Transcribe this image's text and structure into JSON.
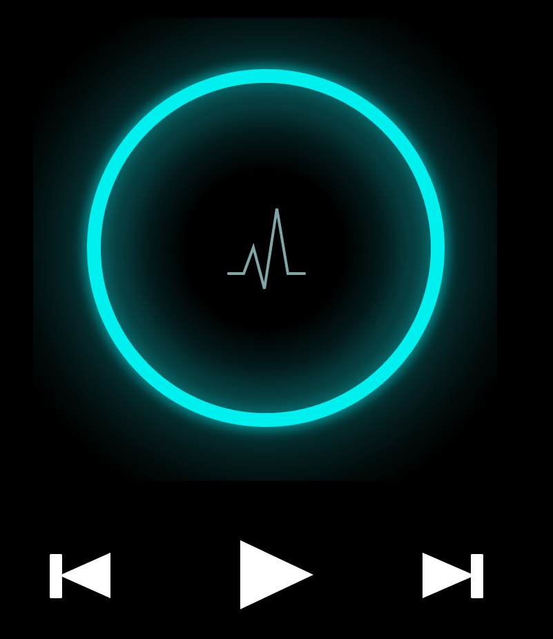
{
  "player": {
    "state": "paused",
    "artwork_icon": "waveform-pulse-icon",
    "accent_color": "#00f0f0",
    "icon_color": "#ffffff"
  },
  "controls": {
    "previous_icon": "skip-previous-icon",
    "play_icon": "play-icon",
    "next_icon": "skip-next-icon"
  }
}
